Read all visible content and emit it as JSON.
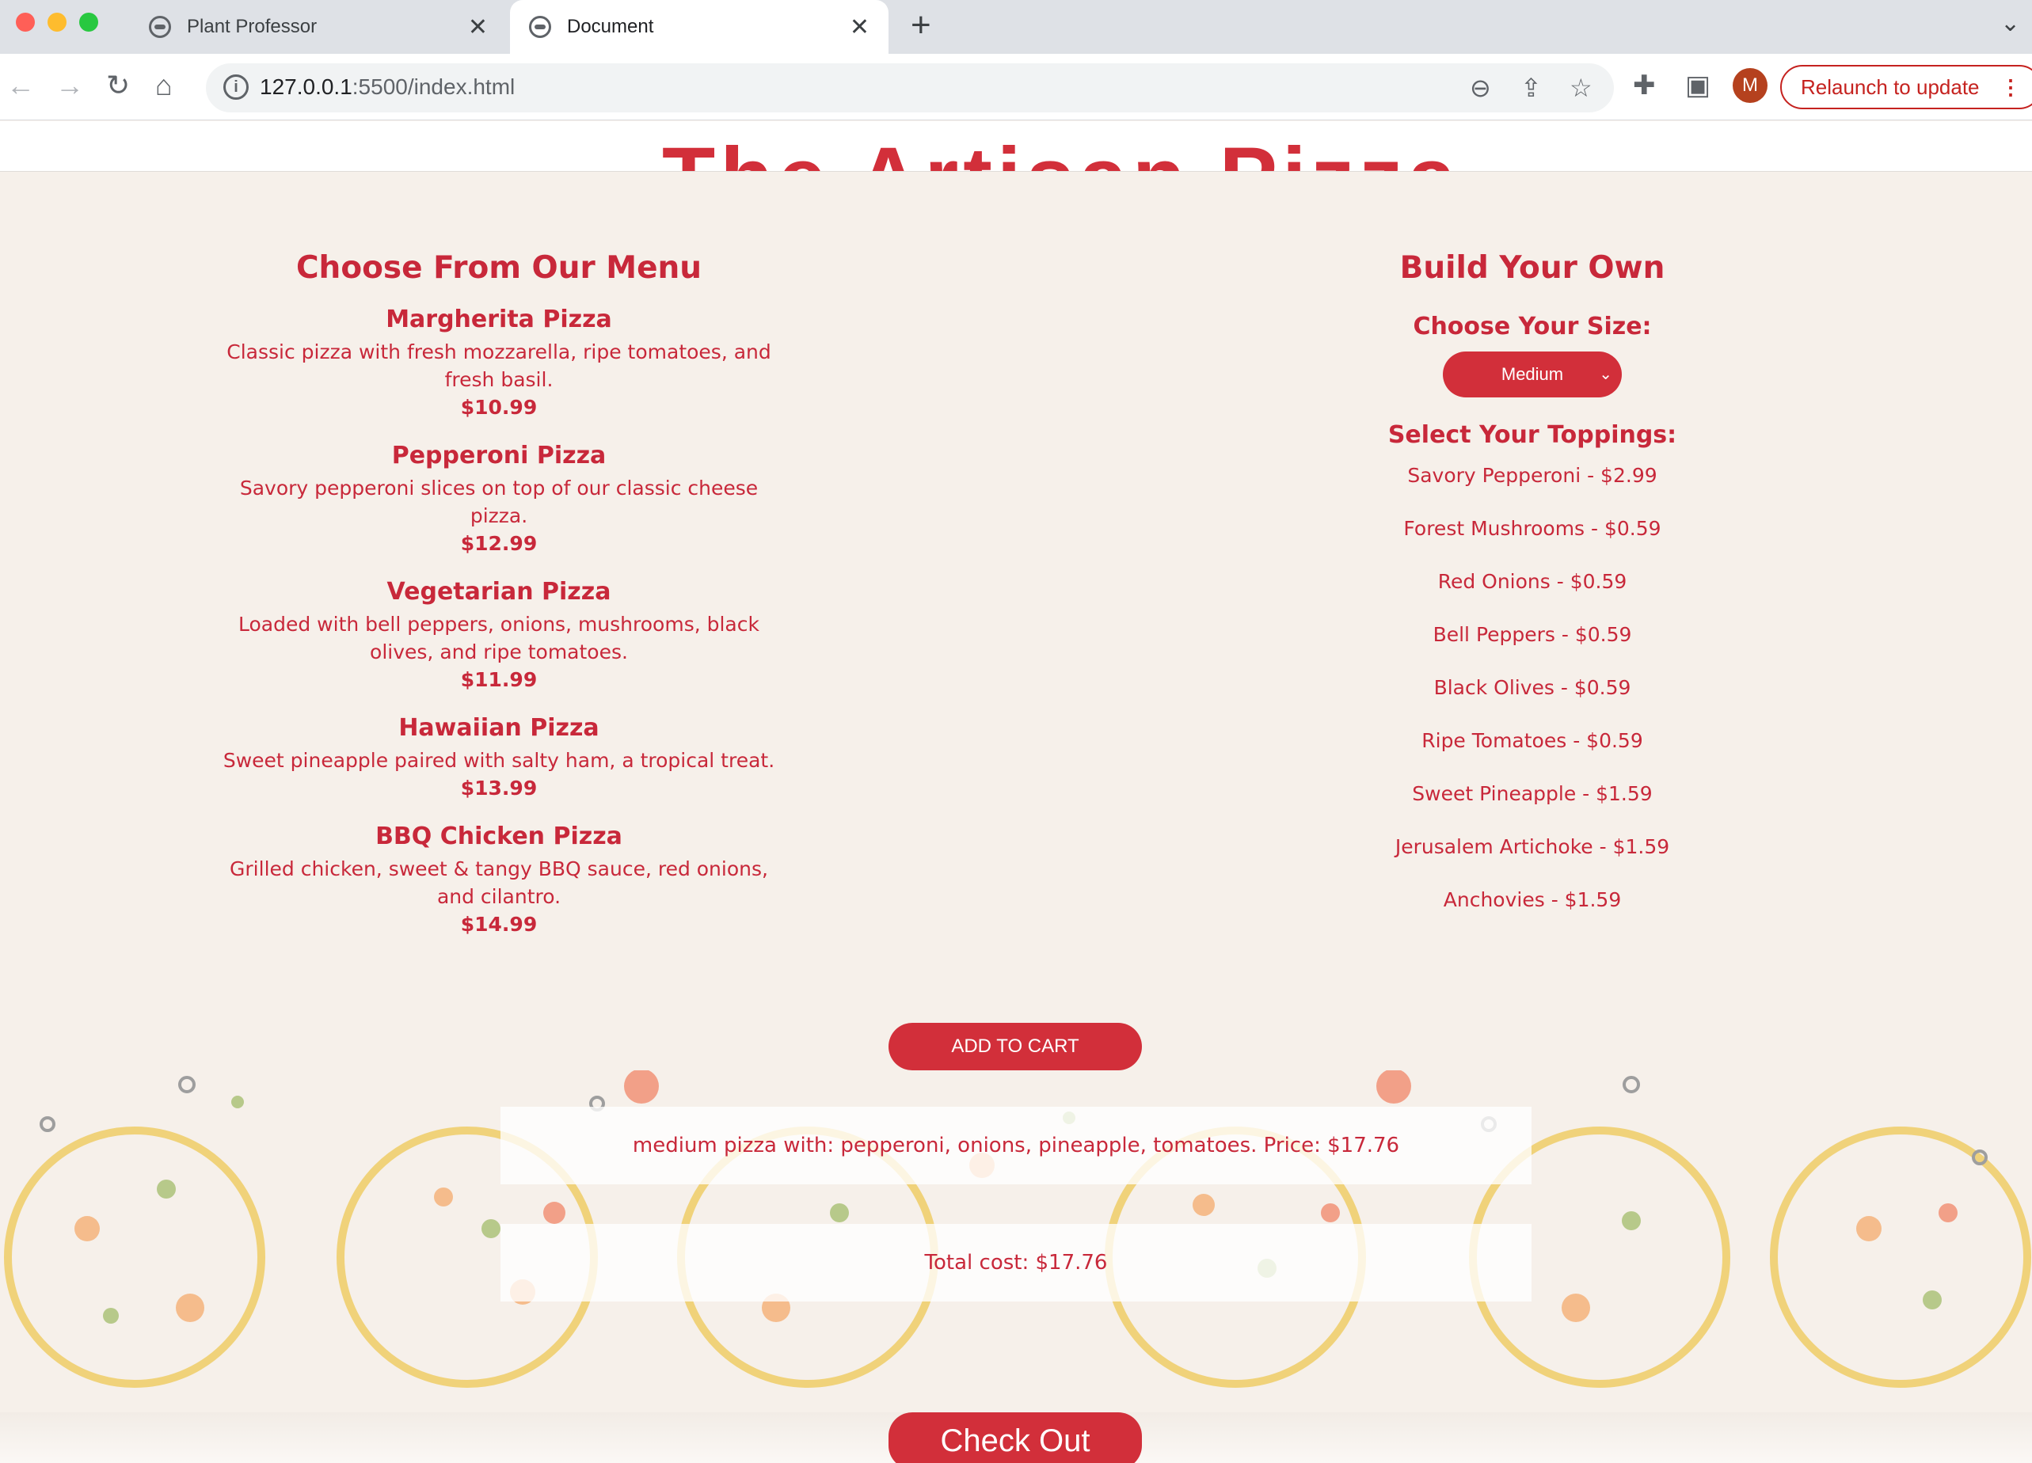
{
  "browser": {
    "tabs": [
      {
        "title": "Plant Professor"
      },
      {
        "title": "Document"
      }
    ],
    "new_tab": "+",
    "url_host": "127.0.0.1",
    "url_rest": ":5500/index.html",
    "profile_initial": "M",
    "relaunch_label": "Relaunch to update"
  },
  "page": {
    "header_fragment": "The Artisan Pizza",
    "menu": {
      "heading": "Choose From Our Menu",
      "pizzas": [
        {
          "name": "Margherita Pizza",
          "desc": "Classic pizza with fresh mozzarella, ripe tomatoes, and fresh basil.",
          "price": "$10.99"
        },
        {
          "name": "Pepperoni Pizza",
          "desc": "Savory pepperoni slices on top of our classic cheese pizza.",
          "price": "$12.99"
        },
        {
          "name": "Vegetarian Pizza",
          "desc": "Loaded with bell peppers, onions, mushrooms, black olives, and ripe tomatoes.",
          "price": "$11.99"
        },
        {
          "name": "Hawaiian Pizza",
          "desc": "Sweet pineapple paired with salty ham, a tropical treat.",
          "price": "$13.99"
        },
        {
          "name": "BBQ Chicken Pizza",
          "desc": "Grilled chicken, sweet & tangy BBQ sauce, red onions, and cilantro.",
          "price": "$14.99"
        }
      ]
    },
    "build": {
      "heading": "Build Your Own",
      "size_label": "Choose Your Size:",
      "size_value": "Medium",
      "toppings_label": "Select Your Toppings:",
      "toppings": [
        "Savory Pepperoni - $2.99",
        "Forest Mushrooms - $0.59",
        "Red Onions - $0.59",
        "Bell Peppers - $0.59",
        "Black Olives - $0.59",
        "Ripe Tomatoes - $0.59",
        "Sweet Pineapple - $1.59",
        "Jerusalem Artichoke - $1.59",
        "Anchovies - $1.59"
      ]
    },
    "add_to_cart": "ADD TO CART",
    "cart_item": "medium pizza with: pepperoni, onions, pineapple, tomatoes. Price: $17.76",
    "total": "Total cost: $17.76",
    "checkout": "Check Out"
  },
  "colors": {
    "accent": "#d22f3a",
    "text": "#c8283a",
    "background": "#f6f0ea"
  }
}
